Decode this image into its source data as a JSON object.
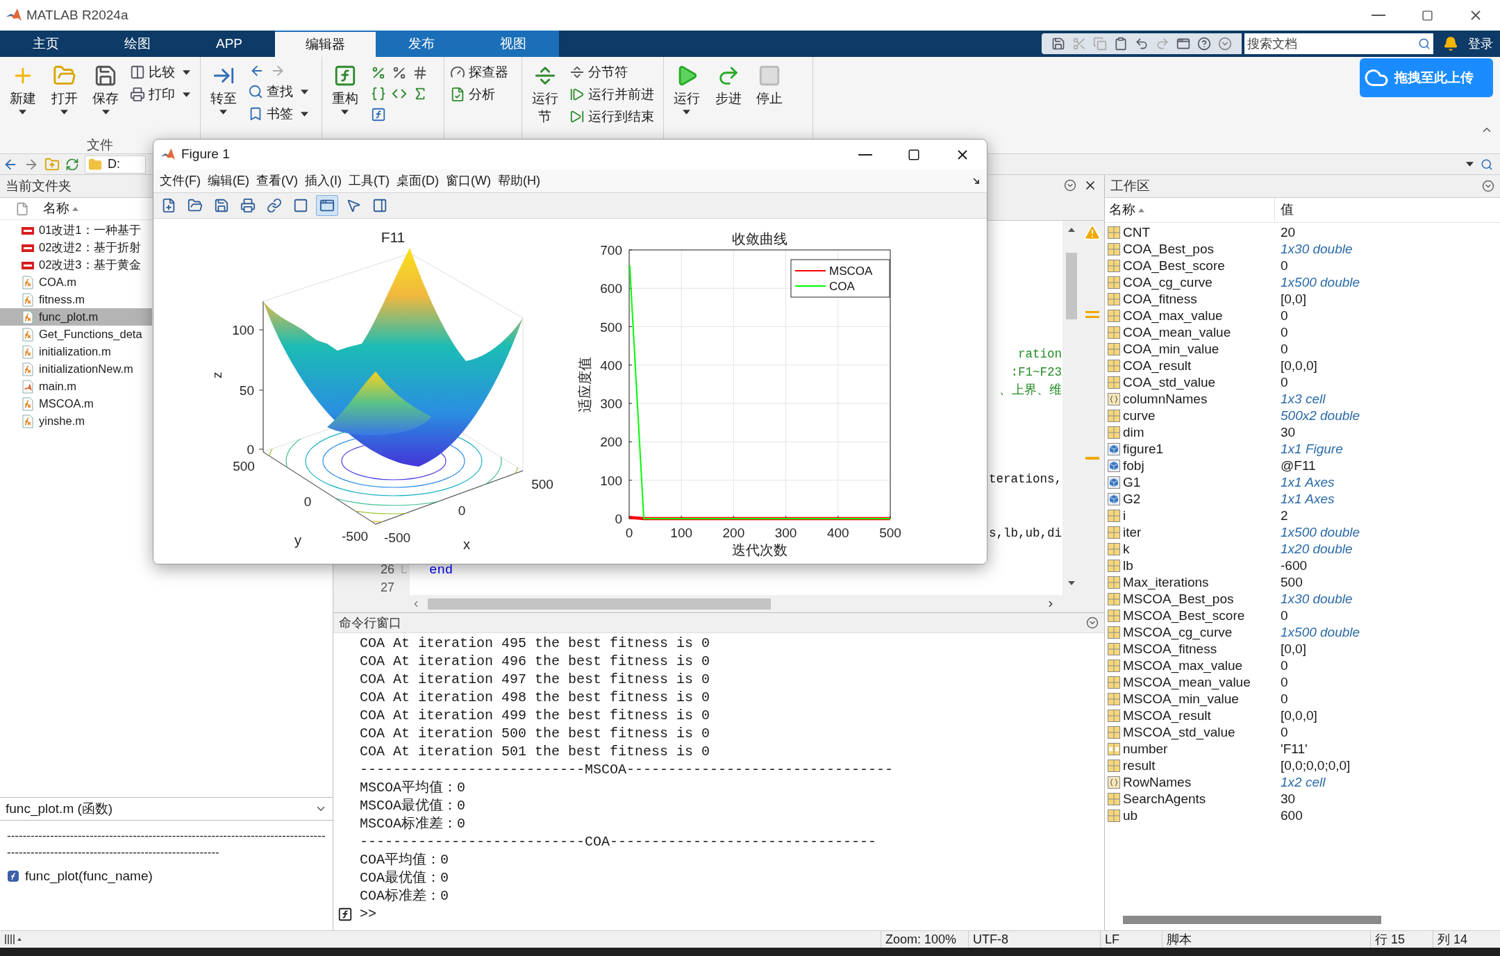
{
  "window": {
    "title": "MATLAB R2024a"
  },
  "tabs": [
    {
      "label": "主页",
      "selected": false,
      "contextual": false
    },
    {
      "label": "绘图",
      "selected": false,
      "contextual": false
    },
    {
      "label": "APP",
      "selected": false,
      "contextual": false
    },
    {
      "label": "编辑器",
      "selected": true,
      "contextual": true
    },
    {
      "label": "发布",
      "selected": false,
      "contextual": true
    },
    {
      "label": "视图",
      "selected": false,
      "contextual": true
    }
  ],
  "search": {
    "placeholder": "搜索文档"
  },
  "login": "登录",
  "ribbon": {
    "groups": [
      {
        "label": "文件",
        "buttons": [
          {
            "kind": "large",
            "label": "新建",
            "dropdown": true
          },
          {
            "kind": "large",
            "label": "打开",
            "dropdown": true
          },
          {
            "kind": "large",
            "label": "保存",
            "dropdown": true
          },
          {
            "kind": "small",
            "label": "比较",
            "dropdown": true
          },
          {
            "kind": "small",
            "label": "打印",
            "dropdown": true
          }
        ]
      },
      {
        "buttons": [
          {
            "kind": "large",
            "label": "转至",
            "dropdown": true
          },
          {
            "kind": "small",
            "label": "查找",
            "dropdown": true
          },
          {
            "kind": "small",
            "label": "书签",
            "dropdown": true
          }
        ]
      },
      {
        "buttons": [
          {
            "kind": "large",
            "label": "重构",
            "dropdown": true
          }
        ]
      },
      {
        "buttons": [
          {
            "kind": "small",
            "label": "探查器",
            "dropdown": false
          },
          {
            "kind": "small",
            "label": "分析",
            "dropdown": false
          }
        ]
      },
      {
        "buttons": [
          {
            "kind": "large",
            "label": "运行节",
            "dropdown": false
          },
          {
            "kind": "small",
            "label": "分节符",
            "dropdown": false
          },
          {
            "kind": "small",
            "label": "运行并前进",
            "dropdown": false
          },
          {
            "kind": "small",
            "label": "运行到结束",
            "dropdown": false
          }
        ]
      },
      {
        "buttons": [
          {
            "kind": "large",
            "label": "运行",
            "dropdown": true
          },
          {
            "kind": "large",
            "label": "步进",
            "dropdown": false
          },
          {
            "kind": "large",
            "label": "停止",
            "dropdown": false
          }
        ]
      }
    ],
    "upload_button": "拖拽至此上传"
  },
  "address_bar": {
    "path": "D:"
  },
  "current_folder": {
    "title": "当前文件夹",
    "column": "名称",
    "files": [
      {
        "name": "01改进1：一种基于",
        "kind": "pdf",
        "selected": false
      },
      {
        "name": "02改进2：基于折射",
        "kind": "pdf",
        "selected": false
      },
      {
        "name": "02改进3：基于黄金",
        "kind": "pdf",
        "selected": false
      },
      {
        "name": "COA.m",
        "kind": "function",
        "selected": false
      },
      {
        "name": "fitness.m",
        "kind": "function",
        "selected": false
      },
      {
        "name": "func_plot.m",
        "kind": "function",
        "selected": true
      },
      {
        "name": "Get_Functions_deta",
        "kind": "function",
        "selected": false
      },
      {
        "name": "initialization.m",
        "kind": "function",
        "selected": false
      },
      {
        "name": "initializationNew.m",
        "kind": "function",
        "selected": false
      },
      {
        "name": "main.m",
        "kind": "script",
        "selected": false
      },
      {
        "name": "MSCOA.m",
        "kind": "function",
        "selected": false
      },
      {
        "name": "yinshe.m",
        "kind": "function",
        "selected": false
      }
    ],
    "details": {
      "title": "func_plot.m (函数)",
      "description": "---------------------------------------------------------------------------------------------------------------------------------------",
      "signature": "func_plot(func_name)"
    }
  },
  "editor": {
    "fragments": [
      {
        "kind": "comment",
        "text": "ration"
      },
      {
        "kind": "comment",
        "text": ":F1~F23"
      },
      {
        "kind": "comment",
        "text": "、上界、维"
      },
      {
        "kind": "code",
        "text": "terations,"
      },
      {
        "kind": "code",
        "text": "s,lb,ub,di"
      }
    ],
    "lines": [
      {
        "number": "26",
        "kind": "keyword",
        "text": "end"
      },
      {
        "number": "27"
      }
    ]
  },
  "command_window": {
    "title": "命令行窗口",
    "lines": [
      "COA At iteration 495 the best fitness is 0",
      "COA At iteration 496 the best fitness is 0",
      "COA At iteration 497 the best fitness is 0",
      "COA At iteration 498 the best fitness is 0",
      "COA At iteration 499 the best fitness is 0",
      "COA At iteration 500 the best fitness is 0",
      "COA At iteration 501 the best fitness is 0",
      "---------------------------MSCOA--------------------------------",
      "MSCOA平均值：0",
      "MSCOA最优值：0",
      "MSCOA标准差：0",
      "---------------------------COA--------------------------------",
      "COA平均值：0",
      "COA最优值：0",
      "COA标准差：0"
    ],
    "prompt": ">>"
  },
  "workspace": {
    "title": "工作区",
    "columns": [
      "名称",
      "值"
    ],
    "variables": [
      {
        "name": "CNT",
        "value": "20",
        "kind": "matrix",
        "summary": false
      },
      {
        "name": "COA_Best_pos",
        "value": "1x30 double",
        "kind": "matrix",
        "summary": true
      },
      {
        "name": "COA_Best_score",
        "value": "0",
        "kind": "matrix",
        "summary": false
      },
      {
        "name": "COA_cg_curve",
        "value": "1x500 double",
        "kind": "matrix",
        "summary": true
      },
      {
        "name": "COA_fitness",
        "value": "[0,0]",
        "kind": "matrix",
        "summary": false
      },
      {
        "name": "COA_max_value",
        "value": "0",
        "kind": "matrix",
        "summary": false
      },
      {
        "name": "COA_mean_value",
        "value": "0",
        "kind": "matrix",
        "summary": false
      },
      {
        "name": "COA_min_value",
        "value": "0",
        "kind": "matrix",
        "summary": false
      },
      {
        "name": "COA_result",
        "value": "[0,0,0]",
        "kind": "matrix",
        "summary": false
      },
      {
        "name": "COA_std_value",
        "value": "0",
        "kind": "matrix",
        "summary": false
      },
      {
        "name": "columnNames",
        "value": "1x3 cell",
        "kind": "cell",
        "summary": true
      },
      {
        "name": "curve",
        "value": "500x2 double",
        "kind": "matrix",
        "summary": true
      },
      {
        "name": "dim",
        "value": "30",
        "kind": "matrix",
        "summary": false
      },
      {
        "name": "figure1",
        "value": "1x1 Figure",
        "kind": "object",
        "summary": true
      },
      {
        "name": "fobj",
        "value": "@F11",
        "kind": "object",
        "summary": false
      },
      {
        "name": "G1",
        "value": "1x1 Axes",
        "kind": "object",
        "summary": true
      },
      {
        "name": "G2",
        "value": "1x1 Axes",
        "kind": "object",
        "summary": true
      },
      {
        "name": "i",
        "value": "2",
        "kind": "matrix",
        "summary": false
      },
      {
        "name": "iter",
        "value": "1x500 double",
        "kind": "matrix",
        "summary": true
      },
      {
        "name": "k",
        "value": "1x20 double",
        "kind": "matrix",
        "summary": true
      },
      {
        "name": "lb",
        "value": "-600",
        "kind": "matrix",
        "summary": false
      },
      {
        "name": "Max_iterations",
        "value": "500",
        "kind": "matrix",
        "summary": false
      },
      {
        "name": "MSCOA_Best_pos",
        "value": "1x30 double",
        "kind": "matrix",
        "summary": true
      },
      {
        "name": "MSCOA_Best_score",
        "value": "0",
        "kind": "matrix",
        "summary": false
      },
      {
        "name": "MSCOA_cg_curve",
        "value": "1x500 double",
        "kind": "matrix",
        "summary": true
      },
      {
        "name": "MSCOA_fitness",
        "value": "[0,0]",
        "kind": "matrix",
        "summary": false
      },
      {
        "name": "MSCOA_max_value",
        "value": "0",
        "kind": "matrix",
        "summary": false
      },
      {
        "name": "MSCOA_mean_value",
        "value": "0",
        "kind": "matrix",
        "summary": false
      },
      {
        "name": "MSCOA_min_value",
        "value": "0",
        "kind": "matrix",
        "summary": false
      },
      {
        "name": "MSCOA_result",
        "value": "[0,0,0]",
        "kind": "matrix",
        "summary": false
      },
      {
        "name": "MSCOA_std_value",
        "value": "0",
        "kind": "matrix",
        "summary": false
      },
      {
        "name": "number",
        "value": "'F11'",
        "kind": "char",
        "summary": false
      },
      {
        "name": "result",
        "value": "[0,0;0,0;0,0]",
        "kind": "matrix",
        "summary": false
      },
      {
        "name": "RowNames",
        "value": "1x2 cell",
        "kind": "cell",
        "summary": true
      },
      {
        "name": "SearchAgents",
        "value": "30",
        "kind": "matrix",
        "summary": false
      },
      {
        "name": "ub",
        "value": "600",
        "kind": "matrix",
        "summary": false
      }
    ]
  },
  "status_bar": [
    "Zoom: 100%",
    "UTF-8",
    "LF",
    "脚本",
    "行 15",
    "列 14"
  ],
  "figure": {
    "title": "Figure 1",
    "menu": [
      "文件(F)",
      "编辑(E)",
      "查看(V)",
      "插入(I)",
      "工具(T)",
      "桌面(D)",
      "窗口(W)",
      "帮助(H)"
    ],
    "toolbar": [
      {
        "selected": false
      },
      {
        "selected": false
      },
      {
        "selected": false
      },
      {
        "selected": false
      },
      {
        "selected": false
      },
      {
        "selected": false
      },
      {
        "selected": true
      },
      {
        "selected": false
      },
      {
        "selected": false
      }
    ],
    "surface_plot": {
      "title": "F11",
      "zlabel": "z",
      "ylabel": "y",
      "xlabel": "x",
      "zticks": [
        "100",
        "50",
        "0"
      ],
      "yticks": [
        "500",
        "0",
        "-500"
      ],
      "xticks": [
        "-500",
        "0",
        "500"
      ]
    },
    "chart_data": {
      "type": "line",
      "title": "收敛曲线",
      "xlabel": "迭代次数",
      "ylabel": "适应度值",
      "x": [
        1,
        28,
        500
      ],
      "series": [
        {
          "name": "MSCOA",
          "color": "#ff0000",
          "values": [
            3,
            0,
            0
          ]
        },
        {
          "name": "COA",
          "color": "#00ff00",
          "values": [
            660,
            0,
            0
          ]
        }
      ],
      "grid": true,
      "legend": true,
      "xlim": [
        0,
        500
      ],
      "ylim": [
        0,
        700
      ],
      "xticks": [
        0,
        100,
        200,
        300,
        400,
        500
      ],
      "yticks": [
        0,
        100,
        200,
        300,
        400,
        500,
        600,
        700
      ]
    }
  }
}
